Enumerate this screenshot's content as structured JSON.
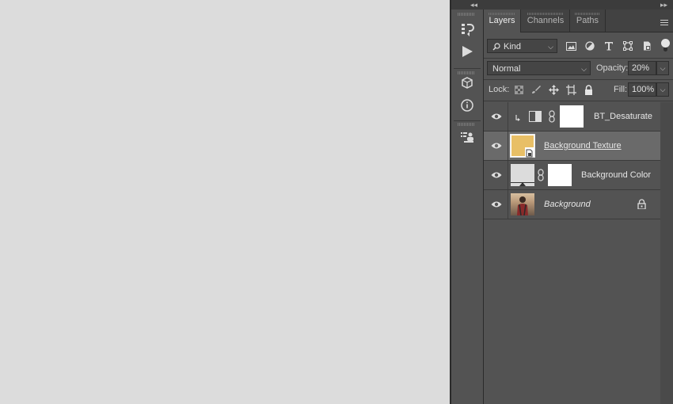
{
  "tabs": [
    {
      "label": "Layers",
      "active": true
    },
    {
      "label": "Channels",
      "active": false
    },
    {
      "label": "Paths",
      "active": false
    }
  ],
  "filter": {
    "kind_label": "Kind"
  },
  "blend": {
    "mode": "Normal",
    "opacity_label": "Opacity:",
    "opacity_value": "20%"
  },
  "lock": {
    "label": "Lock:",
    "fill_label": "Fill:",
    "fill_value": "100%"
  },
  "layers": [
    {
      "name": "BT_Desaturate",
      "type": "adjustment",
      "clipped": true,
      "selected": false,
      "italic": false
    },
    {
      "name": "Background Texture",
      "type": "smart-object",
      "selected": true,
      "italic": false,
      "underline": true,
      "thumb_color": "#e8bf66"
    },
    {
      "name": "Background Color",
      "type": "fill",
      "selected": false,
      "italic": false
    },
    {
      "name": "Background",
      "type": "image",
      "selected": false,
      "italic": true,
      "locked": true
    }
  ],
  "colors": {
    "canvas": "#dcdcdc",
    "panel": "#535353",
    "selected_row": "#6a6a6a",
    "texture_thumb": "#e8bf66"
  },
  "tool_icons": [
    "history-icon",
    "play-actions-icon",
    "3d-cube-icon",
    "info-icon",
    "properties-icon"
  ]
}
